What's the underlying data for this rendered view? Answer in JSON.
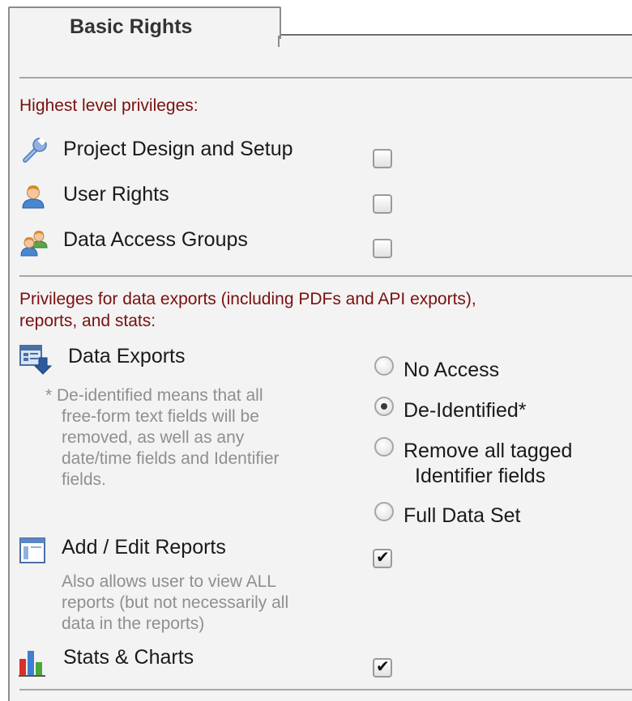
{
  "tab": {
    "label": "Basic Rights"
  },
  "highest": {
    "heading": "Highest level privileges:",
    "items": [
      {
        "label": "Project Design and Setup",
        "icon": "wrench-icon",
        "checked": false
      },
      {
        "label": "User Rights",
        "icon": "user-icon",
        "checked": false
      },
      {
        "label": "Data Access Groups",
        "icon": "user-group-icon",
        "checked": false
      }
    ]
  },
  "exports": {
    "heading_line1": "Privileges for data exports (including PDFs and API exports),",
    "heading_line2": "reports, and stats:",
    "data_exports": {
      "label": "Data Exports",
      "icon": "export-arrow-icon",
      "note_lines": [
        "* De-identified means that all",
        "free-form text fields will be",
        "removed, as well as any",
        "date/time fields and Identifier",
        "fields."
      ],
      "options": [
        {
          "label": "No Access",
          "selected": false
        },
        {
          "label": "De-Identified*",
          "selected": true
        },
        {
          "label_line1": "Remove all tagged",
          "label_line2": "Identifier fields",
          "selected": false
        },
        {
          "label": "Full Data Set",
          "selected": false
        }
      ]
    },
    "reports": {
      "label": "Add / Edit Reports",
      "icon": "report-icon",
      "checked": true,
      "note_lines": [
        "Also allows user to view ALL",
        "reports (but not necessarily all",
        "data in the reports)"
      ]
    },
    "stats": {
      "label": "Stats & Charts",
      "icon": "bar-chart-icon",
      "checked": true
    }
  },
  "colors": {
    "section_heading": "#7a0f0f",
    "note": "#8f8f8f",
    "panel_bg": "#f3f3f3"
  }
}
